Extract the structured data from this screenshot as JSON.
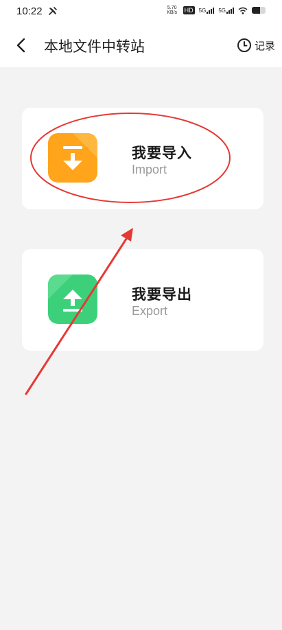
{
  "status_bar": {
    "time": "10:22",
    "speed_value": "5.70",
    "speed_unit": "KB/s",
    "hd_badge": "HD",
    "network1": "5G",
    "network2": "5G"
  },
  "header": {
    "title": "本地文件中转站",
    "records_label": "记录"
  },
  "cards": {
    "import": {
      "title": "我要导入",
      "subtitle": "Import"
    },
    "export": {
      "title": "我要导出",
      "subtitle": "Export"
    }
  },
  "icons": {
    "back": "chevron-left-icon",
    "records": "clock-icon",
    "import": "download-arrow-icon",
    "export": "upload-arrow-icon",
    "status_tool": "tools-icon",
    "wifi": "wifi-icon",
    "battery": "battery-icon"
  },
  "colors": {
    "import_icon": "#FFA41B",
    "export_icon": "#3DD07A",
    "annotation": "#E53935"
  },
  "battery_level": 0.6
}
